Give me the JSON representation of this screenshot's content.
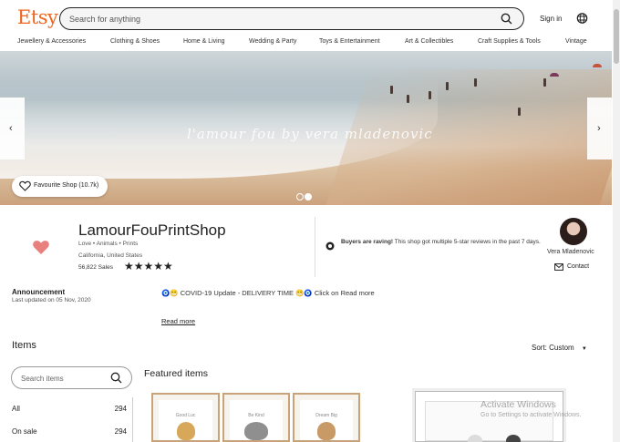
{
  "header": {
    "logo": "Etsy",
    "search_placeholder": "Search for anything",
    "signin_label": "Sign in",
    "accent_color": "#F1641E"
  },
  "categories": [
    "Jewellery & Accessories",
    "Clothing & Shoes",
    "Home & Living",
    "Wedding & Party",
    "Toys & Entertainment",
    "Art & Collectibles",
    "Craft Supplies & Tools",
    "Vintage"
  ],
  "banner": {
    "script_text": "l'amour fou by vera mladenovic",
    "favourite_label": "Favourite Shop (10.7k)",
    "prev_icon": "‹",
    "next_icon": "›"
  },
  "shop": {
    "name": "LamourFouPrintShop",
    "tagline": "Love • Animals • Prints",
    "location": "California, United States",
    "sales": "56,822 Sales",
    "stars": "★★★★★",
    "rating": 5,
    "rave_title": "Buyers are raving!",
    "rave_text": " This shop got multiple 5-star reviews in the past 7 days.",
    "owner_name": "Vera Mladenovic",
    "contact_label": "Contact"
  },
  "announcement": {
    "title": "Announcement",
    "updated": "Last updated on 05 Nov, 2020",
    "text": "🧿😁 COVID-19 Update - DELIVERY TIME 😁🧿 Click on Read more",
    "read_more": "Read more"
  },
  "items": {
    "heading": "Items",
    "sort_label": "Sort: Custom",
    "search_placeholder": "Search items",
    "featured_heading": "Featured items",
    "sections": [
      {
        "label": "All",
        "count": "294"
      },
      {
        "label": "On sale",
        "count": "294"
      }
    ],
    "thumb_captions": [
      "Good Luc",
      "Be Kind",
      "Dream Big"
    ]
  },
  "watermark": {
    "title": "Activate Windows",
    "subtitle": "Go to Settings to activate Windows."
  }
}
